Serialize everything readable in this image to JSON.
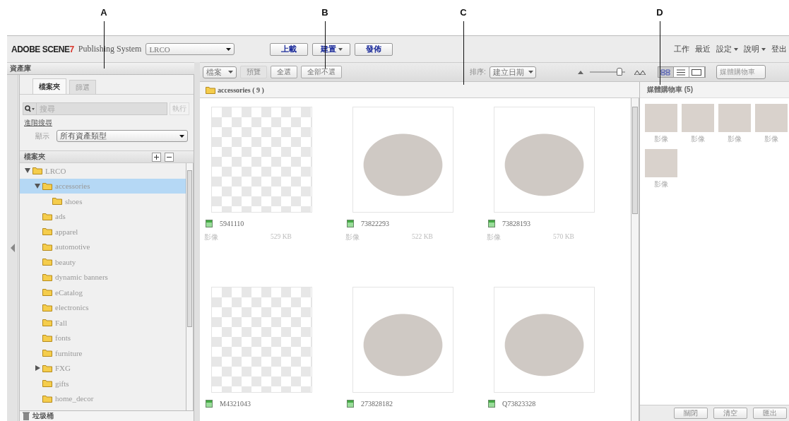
{
  "callouts": [
    "A",
    "B",
    "C",
    "D"
  ],
  "header": {
    "logo": "ADOBE SCENE",
    "logo_accent": "7",
    "product": "Publishing System",
    "company_select": "LRCO",
    "actions": [
      {
        "label": "上載",
        "dropdown": false
      },
      {
        "label": "建置",
        "dropdown": true
      },
      {
        "label": "發佈",
        "dropdown": false
      }
    ],
    "menu": [
      {
        "label": "工作",
        "dropdown": false
      },
      {
        "label": "最近",
        "dropdown": false
      },
      {
        "label": "設定",
        "dropdown": true
      },
      {
        "label": "說明",
        "dropdown": true
      },
      {
        "label": "登出",
        "dropdown": false
      }
    ]
  },
  "asset_library": {
    "title": "資產庫",
    "tabs": [
      {
        "label": "檔案夾",
        "selected": true
      },
      {
        "label": "篩選",
        "selected": false
      }
    ],
    "search": {
      "placeholder": "搜尋",
      "button": "執行"
    },
    "advanced_search": "進階搜尋",
    "show_label": "顯示",
    "show_select": "所有資產類型",
    "folders_title": "檔案夾",
    "tree": [
      {
        "name": "LRCO",
        "expanded": true,
        "selected": false,
        "children": [
          {
            "name": "accessories",
            "expanded": true,
            "selected": true,
            "children": [
              {
                "name": "shoes",
                "selected": false
              }
            ]
          },
          {
            "name": "ads",
            "selected": false
          },
          {
            "name": "apparel",
            "selected": false
          },
          {
            "name": "automotive",
            "selected": false
          },
          {
            "name": "beauty",
            "selected": false
          },
          {
            "name": "dynamic banners",
            "selected": false
          },
          {
            "name": "eCatalog",
            "selected": false
          },
          {
            "name": "electronics",
            "selected": false
          },
          {
            "name": "Fall",
            "selected": false
          },
          {
            "name": "fonts",
            "selected": false
          },
          {
            "name": "furniture",
            "selected": false
          },
          {
            "name": "FXG",
            "expanded": false,
            "selected": false
          },
          {
            "name": "gifts",
            "selected": false
          },
          {
            "name": "home_decor",
            "selected": false
          }
        ]
      }
    ],
    "trash": "垃圾桶"
  },
  "browser": {
    "file_select": "檔案",
    "buttons": [
      {
        "label": "預覽",
        "disabled": true
      },
      {
        "label": "全選",
        "disabled": false
      },
      {
        "label": "全部不選",
        "disabled": false
      }
    ],
    "sort_label": "排序:",
    "sort_select": "建立日期",
    "zoom_slider": {
      "level": 0.85
    },
    "views": [
      {
        "kind": "grid",
        "selected": true
      },
      {
        "kind": "list",
        "selected": false
      },
      {
        "kind": "single",
        "selected": false
      }
    ],
    "panel_select": "媒體購物車",
    "folder": "accessories ( 9 )",
    "assets": [
      {
        "name": "5941110",
        "type": "影像",
        "size": "529 KB",
        "transparent": true
      },
      {
        "name": "73822293",
        "type": "影像",
        "size": "522 KB",
        "transparent": false
      },
      {
        "name": "73828193",
        "type": "影像",
        "size": "570 KB",
        "transparent": false
      },
      {
        "name": "M4321043",
        "transparent": true
      },
      {
        "name": "273828182",
        "transparent": false
      },
      {
        "name": "Q73823328",
        "transparent": false
      }
    ]
  },
  "cart": {
    "title": "媒體購物車 (5)",
    "items": [
      {
        "label": "影像"
      },
      {
        "label": "影像"
      },
      {
        "label": "影像"
      },
      {
        "label": "影像"
      },
      {
        "label": "影像"
      }
    ],
    "buttons": [
      "關閉",
      "清空",
      "匯出"
    ]
  }
}
